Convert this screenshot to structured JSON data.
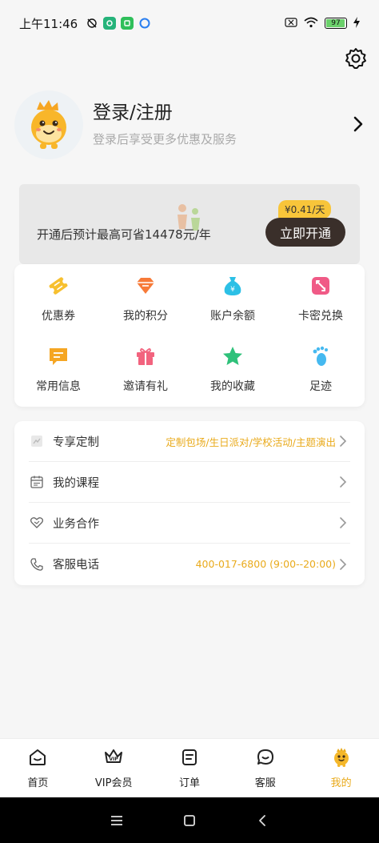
{
  "status_bar": {
    "time": "上午11:46",
    "battery": "97"
  },
  "profile": {
    "title": "登录/注册",
    "subtitle": "登录后享受更多优惠及服务"
  },
  "vip_banner": {
    "text": "开通后预计最高可省14478元/年",
    "price_tag": "¥0.41/天",
    "button": "立即开通"
  },
  "quick_grid": [
    {
      "label": "优惠券",
      "icon": "coupon-icon",
      "color": "#f7c02f"
    },
    {
      "label": "我的积分",
      "icon": "diamond-icon",
      "color": "#f77a38"
    },
    {
      "label": "账户余额",
      "icon": "moneybag-icon",
      "color": "#2cc0e6"
    },
    {
      "label": "卡密兑换",
      "icon": "exchange-card-icon",
      "color": "#f05a86"
    },
    {
      "label": "常用信息",
      "icon": "message-icon",
      "color": "#f5a623"
    },
    {
      "label": "邀请有礼",
      "icon": "gift-icon",
      "color": "#f2637e"
    },
    {
      "label": "我的收藏",
      "icon": "star-icon",
      "color": "#2fc17a"
    },
    {
      "label": "足迹",
      "icon": "footprint-icon",
      "color": "#45b9f0"
    }
  ],
  "menu": [
    {
      "label": "专享定制",
      "value": "定制包场/生日派对/学校活动/主题演出",
      "icon": "custom-icon"
    },
    {
      "label": "我的课程",
      "value": "",
      "icon": "calendar-icon"
    },
    {
      "label": "业务合作",
      "value": "",
      "icon": "heart-handshake-icon"
    },
    {
      "label": "客服电话",
      "value": "400-017-6800 (9:00--20:00)",
      "icon": "phone-icon"
    }
  ],
  "tabs": [
    {
      "label": "首页",
      "icon": "home-icon"
    },
    {
      "label": "VIP会员",
      "icon": "crown-icon"
    },
    {
      "label": "订单",
      "icon": "order-icon"
    },
    {
      "label": "客服",
      "icon": "chat-icon"
    },
    {
      "label": "我的",
      "icon": "mascot-icon"
    }
  ],
  "colors": {
    "accent": "#e9aa1b",
    "vip_button": "#3a2f2a",
    "price_tag": "#f8c53a"
  }
}
